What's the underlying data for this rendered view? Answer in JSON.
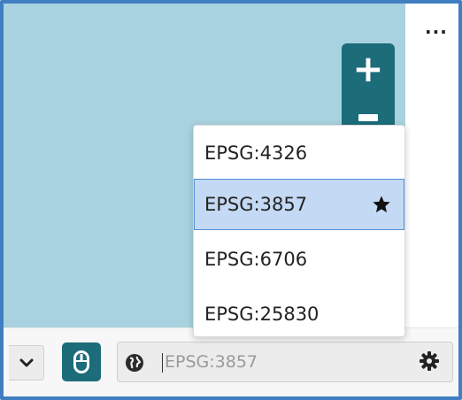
{
  "menu": {
    "more_label": "···"
  },
  "map": {
    "zoom_in_label": "+",
    "background_color": "#a8d2df"
  },
  "crs": {
    "placeholder": "EPSG:3857",
    "options": [
      {
        "label": "EPSG:4326",
        "selected": false
      },
      {
        "label": "EPSG:3857",
        "selected": true,
        "favorite": true
      },
      {
        "label": "EPSG:6706",
        "selected": false
      },
      {
        "label": "EPSG:25830",
        "selected": false
      }
    ]
  },
  "icons": {
    "zoom_out": "minus-icon",
    "dropdown": "chevron-down-icon",
    "mouse": "mouse-icon",
    "globe": "globe-icon",
    "settings": "gear-icon",
    "favorite": "star-icon"
  },
  "colors": {
    "accent": "#1c6c7a",
    "selection": "#c4d9f3",
    "frame": "#3f7fc1"
  }
}
